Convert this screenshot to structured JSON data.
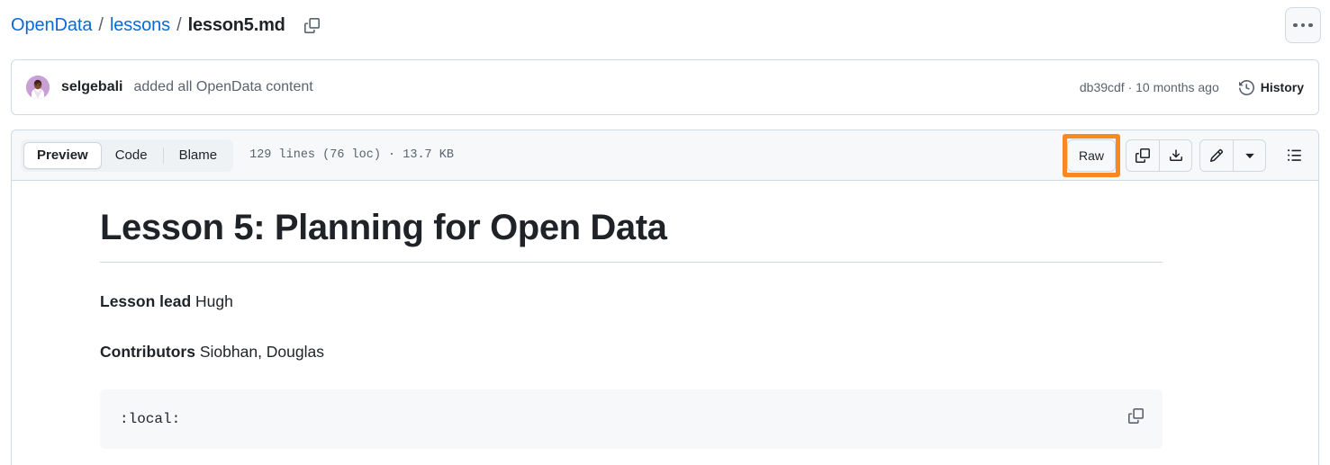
{
  "breadcrumb": {
    "repo": "OpenData",
    "separator": "/",
    "folder": "lessons",
    "file": "lesson5.md",
    "copy_icon": "copy-icon"
  },
  "header": {
    "kebab_icon": "kebab-horizontal-icon"
  },
  "commit": {
    "author": "selgebali",
    "message": "added all OpenData content",
    "sha_and_time": "db39cdf · 10 months ago",
    "history_label": "History",
    "history_icon": "history-clock-icon",
    "avatar_name": "avatar"
  },
  "toolbar": {
    "tabs": [
      {
        "label": "Preview",
        "active": true
      },
      {
        "label": "Code",
        "active": false
      },
      {
        "label": "Blame",
        "active": false
      }
    ],
    "file_meta": "129 lines (76 loc) · 13.7 KB",
    "raw_label": "Raw",
    "highlight_color": "#f8881f",
    "copy_icon": "copy-icon",
    "download_icon": "download-icon",
    "edit_icon": "pencil-icon",
    "dropdown_icon": "chevron-down-icon",
    "outline_icon": "list-unordered-icon"
  },
  "content": {
    "title": "Lesson 5: Planning for Open Data",
    "lines": [
      {
        "label": "Lesson lead",
        "value": "Hugh"
      },
      {
        "label": "Contributors",
        "value": "Siobhan, Douglas"
      }
    ],
    "code": ":local:",
    "code_copy_icon": "copy-icon"
  },
  "colors": {
    "link": "#0969da",
    "text": "#1f2328",
    "muted": "#59636e",
    "border": "#d1d9e0",
    "surface": "#f6f8fa",
    "highlight": "#f8881f"
  }
}
